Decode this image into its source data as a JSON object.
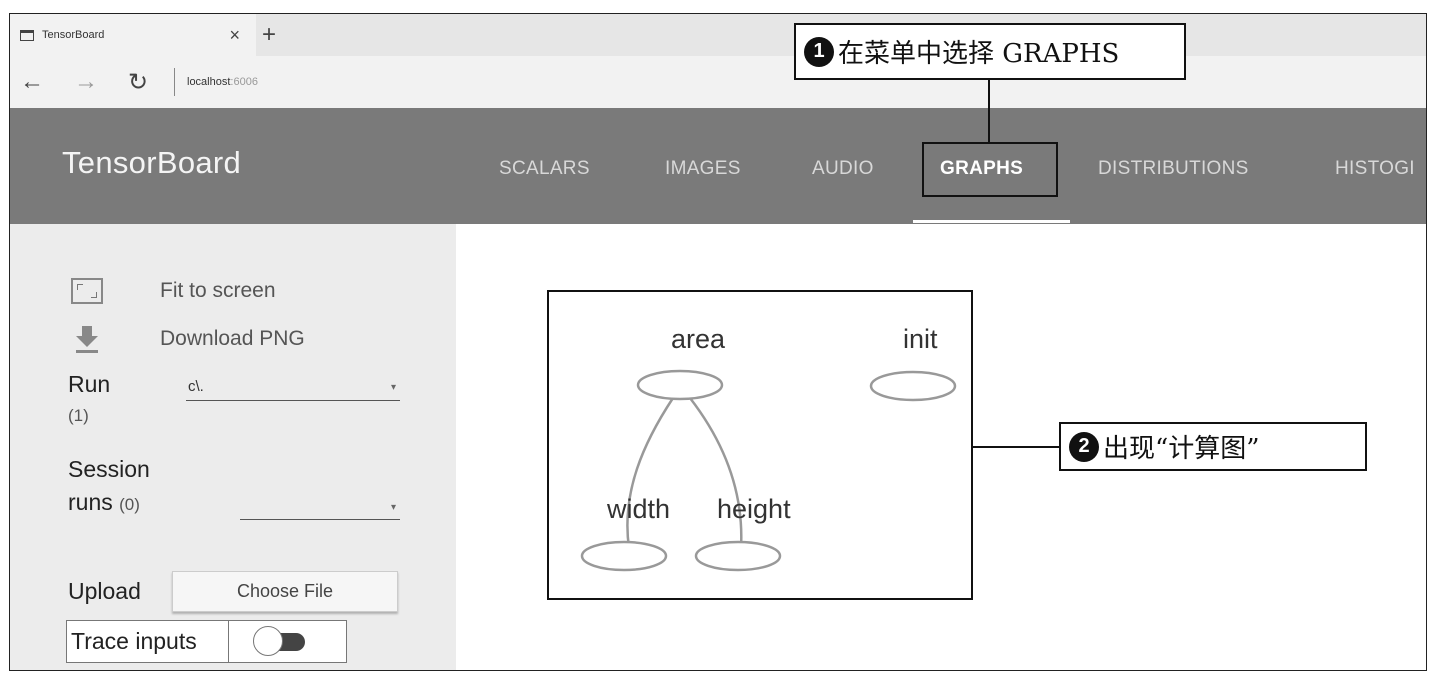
{
  "browser": {
    "tab_title": "TensorBoard",
    "tab_close": "×",
    "new_tab": "+",
    "back": "←",
    "forward": "→",
    "refresh": "↻",
    "url_host": "localhost",
    "url_port": ":6006"
  },
  "header": {
    "brand": "TensorBoard",
    "tabs": [
      {
        "label": "SCALARS",
        "active": false
      },
      {
        "label": "IMAGES",
        "active": false
      },
      {
        "label": "AUDIO",
        "active": false
      },
      {
        "label": "GRAPHS",
        "active": true
      },
      {
        "label": "DISTRIBUTIONS",
        "active": false
      },
      {
        "label": "HISTOGI",
        "active": false
      }
    ]
  },
  "sidebar": {
    "fit_label": "Fit to screen",
    "download_label": "Download PNG",
    "run_label": "Run",
    "run_count": "(1)",
    "run_value": "c\\.",
    "session_label": "Session",
    "runs_label": "runs",
    "session_count": "(0)",
    "session_value": "",
    "upload_label": "Upload",
    "choose_file": "Choose File",
    "trace_inputs": "Trace inputs",
    "trace_enabled": false
  },
  "graph": {
    "nodes": [
      "area",
      "init",
      "width",
      "height"
    ],
    "edges": [
      [
        "area",
        "width"
      ],
      [
        "area",
        "height"
      ]
    ]
  },
  "annotations": {
    "step1_num": "1",
    "step1_text": "在菜单中选择 GRAPHS",
    "step2_num": "2",
    "step2_text": "出现“计算图”"
  },
  "colors": {
    "header_bg": "#7a7a7a",
    "sidebar_bg": "#ececec",
    "node_stroke": "#999999"
  }
}
